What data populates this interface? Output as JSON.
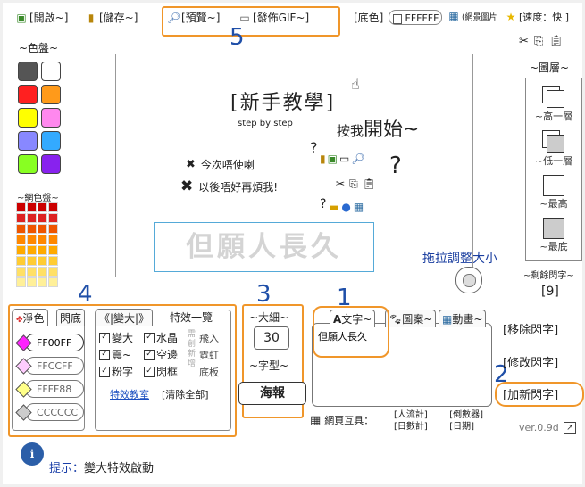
{
  "toolbar": {
    "open": "[開啟~]",
    "save": "[儲存~]",
    "preview": "[預覽~]",
    "publish": "[發佈GIF~]",
    "bg_color_label": "[底色]",
    "bg_color_value": "FFFFFF",
    "stock_image": "(網景圖片",
    "speed": "[速度：快 ]"
  },
  "palette": {
    "title": "~色盤~",
    "colors": [
      "#555555",
      "#ffffff",
      "#ff2020",
      "#ff9a1a",
      "#ffff00",
      "#ff88ee",
      "#8888ff",
      "#33aaff",
      "#88ff22",
      "#8822ee"
    ],
    "gradient_title": "~網色盤~",
    "gradient_rows": [
      "#cc0000",
      "#dd2222",
      "#ee5500",
      "#ff8800",
      "#ffaa00",
      "#ffcc33",
      "#ffe066",
      "#fff099"
    ]
  },
  "canvas": {
    "title": "[新手教學]",
    "subtitle": "step by step",
    "start_prefix": "按我",
    "start_main": "開始~",
    "option1": "今次唔使喇",
    "option2": "以後唔好再煩我!",
    "preview_text": "但願人長久"
  },
  "resize_hint": "拖拉調整大小",
  "numbers": {
    "n1": "1",
    "n2": "2",
    "n3": "3",
    "n4": "4",
    "n5": "5"
  },
  "layers": {
    "title": "~圖層~",
    "up": "~高一層",
    "down": "~低一層",
    "top": "~最高",
    "bottom": "~最底"
  },
  "remaining": {
    "label": "~剩餘閃字~",
    "value": "[9]"
  },
  "color_panel": {
    "tab_solid": "淨色",
    "tab_flash": "閃底",
    "colors": [
      {
        "name": "FF00FF",
        "diamond": "#ff22ff"
      },
      {
        "name": "FFCCFF",
        "diamond": "#ffccff"
      },
      {
        "name": "FFFF88",
        "diamond": "#ffff88"
      },
      {
        "name": "CCCCCC",
        "diamond": "#cccccc"
      }
    ]
  },
  "effects": {
    "tab_enlarge": "《|變大|》",
    "tab_all": "特效一覽",
    "items": [
      "變大",
      "水晶",
      "震~",
      "空邊",
      "粉字",
      "閃框"
    ],
    "side_items": [
      "飛入",
      "霓虹",
      "底板"
    ],
    "side_grey": [
      "需",
      "創",
      "新",
      "增"
    ],
    "tutorial": "特效教室",
    "clear_all": "[清除全部]"
  },
  "size_panel": {
    "size_label": "~大細~",
    "size_value": "30",
    "font_label": "~字型~",
    "font_value": "海報"
  },
  "text_panel": {
    "tab_text": "文字~",
    "tab_image": "圖案~",
    "tab_anim": "動畫~",
    "content": "但願人長久"
  },
  "actions": {
    "remove": "[移除閃字]",
    "edit": "[修改閃字]",
    "add": "[加新閃字]"
  },
  "web_tools": {
    "label": "網頁互具：",
    "counter1": "[人流計]",
    "counter2": "[倒數器]",
    "counter3": "[日數計]",
    "counter4": "[日期]"
  },
  "version": "ver.0.9d",
  "hint": {
    "label": "提示：",
    "text": "變大特效啟動"
  }
}
